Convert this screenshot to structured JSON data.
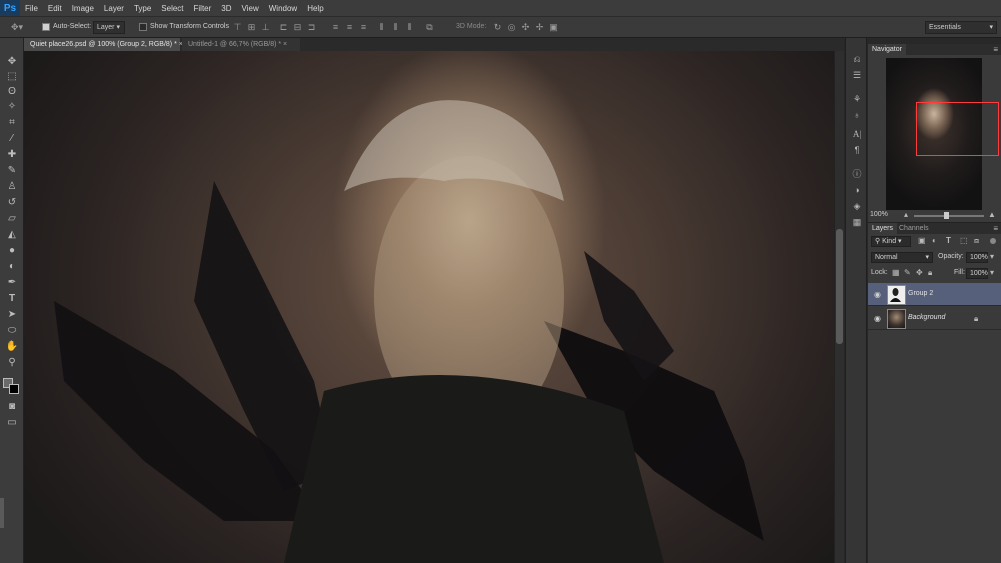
{
  "app": {
    "logo": "Ps"
  },
  "menu": [
    "File",
    "Edit",
    "Image",
    "Layer",
    "Type",
    "Select",
    "Filter",
    "3D",
    "View",
    "Window",
    "Help"
  ],
  "options_bar": {
    "auto_select_label": "Auto-Select:",
    "auto_select_target": "Layer",
    "show_transform_label": "Show Transform Controls",
    "mode_3d_label": "3D Mode:",
    "workspace": "Essentials"
  },
  "tabs": [
    {
      "label": "Quiet place26.psd @ 100% (Group 2, RGB/8) *",
      "close": "×",
      "active": true
    },
    {
      "label": "Untitled-1 @ 66,7% (RGB/8) *",
      "close": "×",
      "active": false
    }
  ],
  "navigator": {
    "title": "Navigator",
    "zoom": "100%"
  },
  "layers_panel": {
    "tabs": [
      "Layers",
      "Channels"
    ],
    "filter_kind": "Kind",
    "blend_mode": "Normal",
    "opacity_label": "Opacity:",
    "opacity_value": "100%",
    "lock_label": "Lock:",
    "fill_label": "Fill:",
    "fill_value": "100%",
    "layers": [
      {
        "name": "Group 2",
        "selected": true
      },
      {
        "name": "Background",
        "selected": false
      }
    ]
  },
  "colors": {
    "selection_frame": "#ff3b3b",
    "selected_layer": "#56607a",
    "ps_blue": "#33a3ff"
  }
}
